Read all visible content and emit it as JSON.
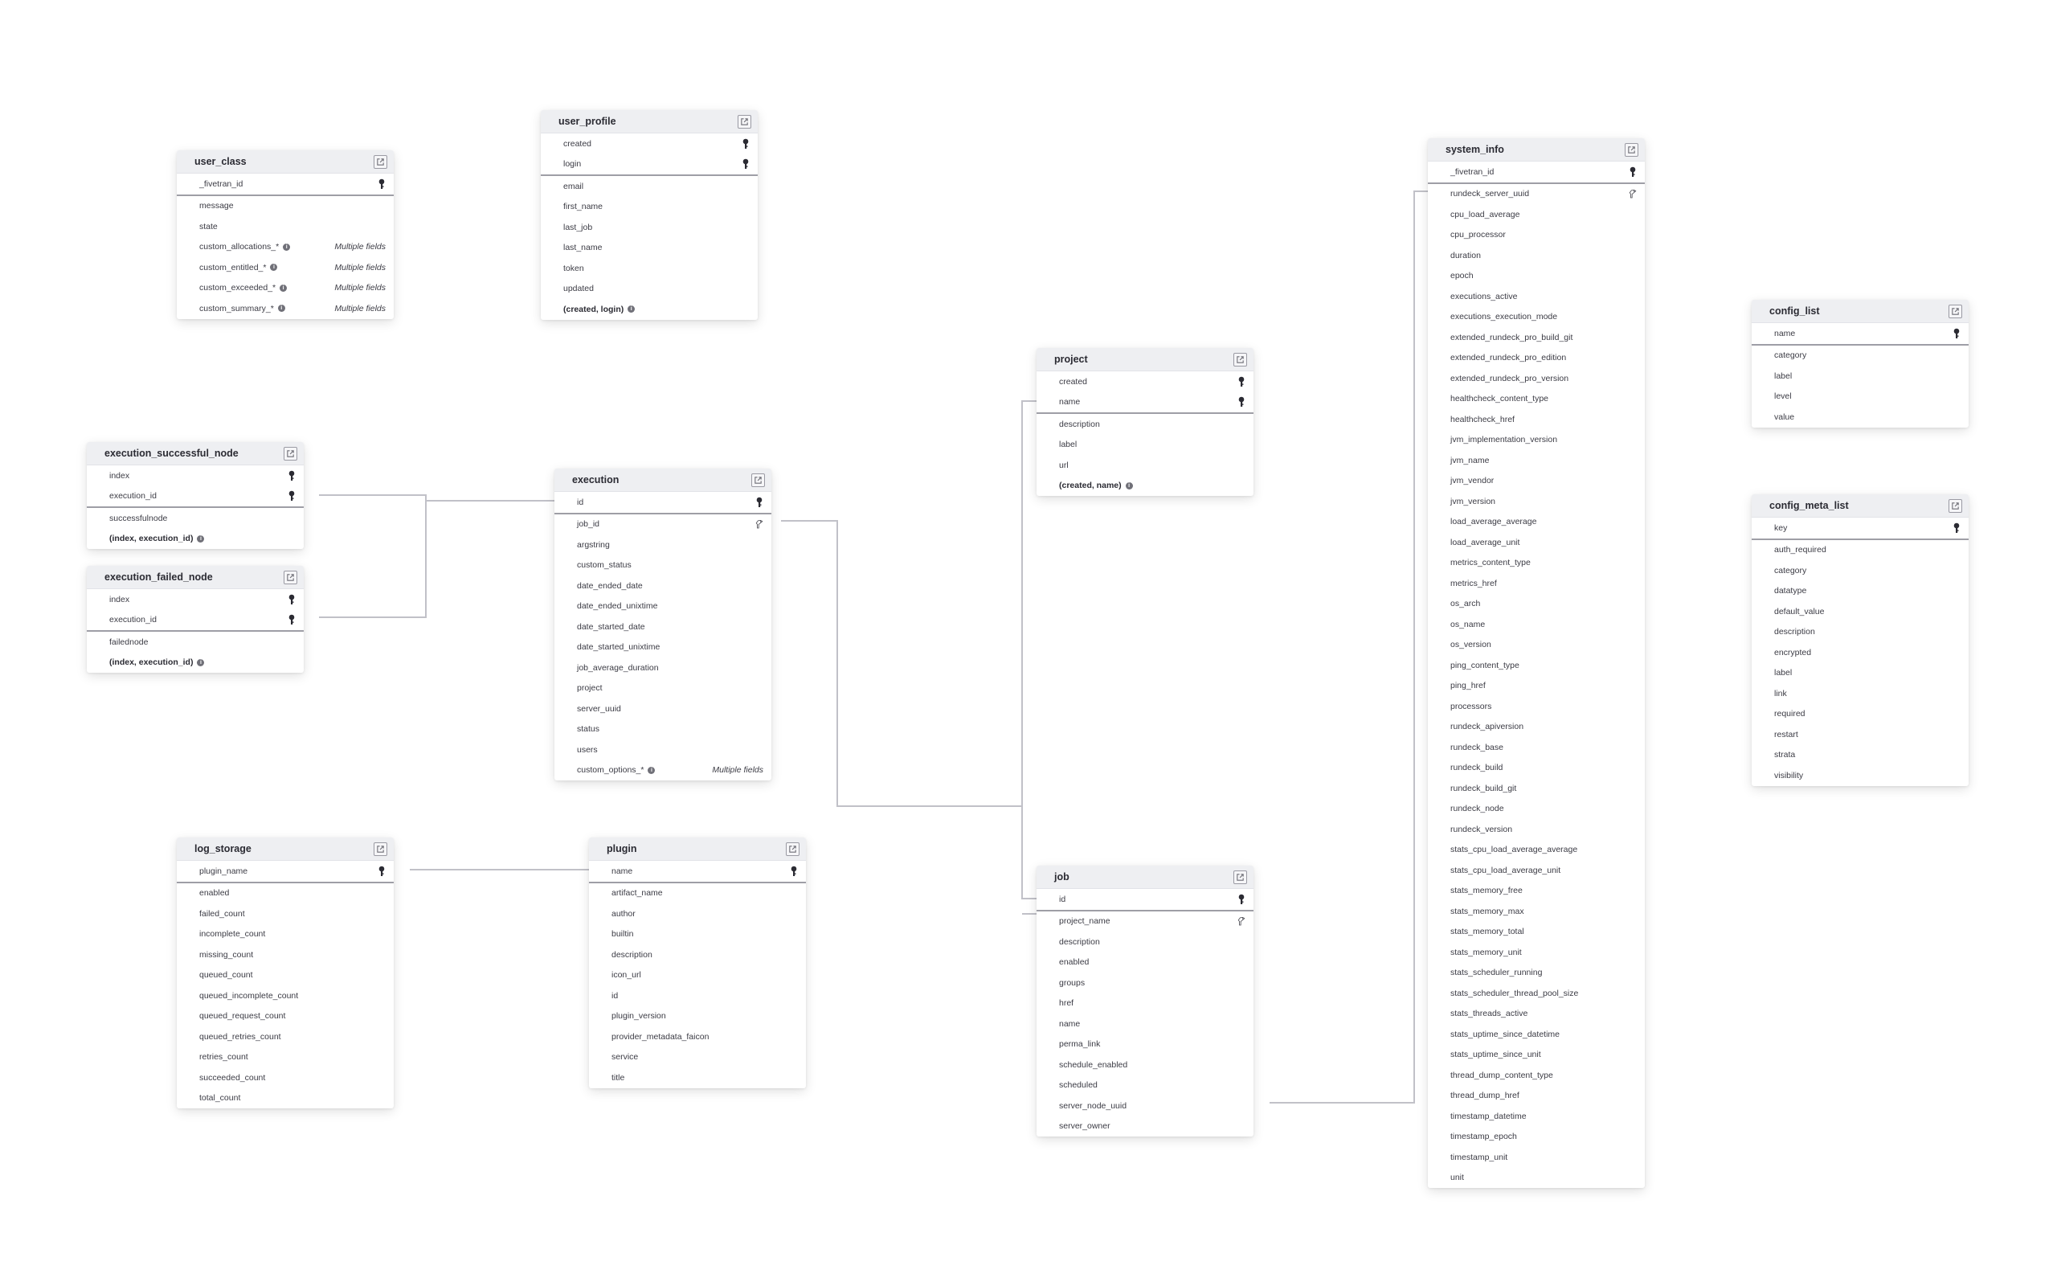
{
  "tables": {
    "user_class": {
      "title": "user_class",
      "pk": [
        {
          "name": "_fivetran_id",
          "icon": "key"
        }
      ],
      "cols": [
        {
          "name": "message"
        },
        {
          "name": "state"
        },
        {
          "name": "custom_allocations_*",
          "info": true,
          "note": "Multiple fields"
        },
        {
          "name": "custom_entitled_*",
          "info": true,
          "note": "Multiple fields"
        },
        {
          "name": "custom_exceeded_*",
          "info": true,
          "note": "Multiple fields"
        },
        {
          "name": "custom_summary_*",
          "info": true,
          "note": "Multiple fields"
        }
      ]
    },
    "user_profile": {
      "title": "user_profile",
      "pk": [
        {
          "name": "created",
          "icon": "key"
        },
        {
          "name": "login",
          "icon": "key"
        }
      ],
      "cols": [
        {
          "name": "email"
        },
        {
          "name": "first_name"
        },
        {
          "name": "last_job"
        },
        {
          "name": "last_name"
        },
        {
          "name": "token"
        },
        {
          "name": "updated"
        },
        {
          "name": "(created, login)",
          "info": true,
          "bold": true
        }
      ]
    },
    "execution_successful_node": {
      "title": "execution_successful_node",
      "pk": [
        {
          "name": "index",
          "icon": "key"
        },
        {
          "name": "execution_id",
          "icon": "key"
        }
      ],
      "cols": [
        {
          "name": "successfulnode"
        },
        {
          "name": "(index, execution_id)",
          "info": true,
          "bold": true
        }
      ]
    },
    "execution_failed_node": {
      "title": "execution_failed_node",
      "pk": [
        {
          "name": "index",
          "icon": "key"
        },
        {
          "name": "execution_id",
          "icon": "key"
        }
      ],
      "cols": [
        {
          "name": "failednode"
        },
        {
          "name": "(index, execution_id)",
          "info": true,
          "bold": true
        }
      ]
    },
    "execution": {
      "title": "execution",
      "pk": [
        {
          "name": "id",
          "icon": "key"
        }
      ],
      "cols": [
        {
          "name": "job_id",
          "icon": "fk"
        },
        {
          "name": "argstring"
        },
        {
          "name": "custom_status"
        },
        {
          "name": "date_ended_date"
        },
        {
          "name": "date_ended_unixtime"
        },
        {
          "name": "date_started_date"
        },
        {
          "name": "date_started_unixtime"
        },
        {
          "name": "job_average_duration"
        },
        {
          "name": "project"
        },
        {
          "name": "server_uuid"
        },
        {
          "name": "status"
        },
        {
          "name": "users"
        },
        {
          "name": "custom_options_*",
          "info": true,
          "note": "Multiple fields"
        }
      ]
    },
    "project": {
      "title": "project",
      "pk": [
        {
          "name": "created",
          "icon": "key"
        },
        {
          "name": "name",
          "icon": "key"
        }
      ],
      "cols": [
        {
          "name": "description"
        },
        {
          "name": "label"
        },
        {
          "name": "url"
        },
        {
          "name": "(created, name)",
          "info": true,
          "bold": true
        }
      ]
    },
    "job": {
      "title": "job",
      "pk": [
        {
          "name": "id",
          "icon": "key"
        }
      ],
      "cols": [
        {
          "name": "project_name",
          "icon": "fk"
        },
        {
          "name": "description"
        },
        {
          "name": "enabled"
        },
        {
          "name": "groups"
        },
        {
          "name": "href"
        },
        {
          "name": "name"
        },
        {
          "name": "perma_link"
        },
        {
          "name": "schedule_enabled"
        },
        {
          "name": "scheduled"
        },
        {
          "name": "server_node_uuid"
        },
        {
          "name": "server_owner"
        }
      ]
    },
    "log_storage": {
      "title": "log_storage",
      "pk": [
        {
          "name": "plugin_name",
          "icon": "key"
        }
      ],
      "cols": [
        {
          "name": "enabled"
        },
        {
          "name": "failed_count"
        },
        {
          "name": "incomplete_count"
        },
        {
          "name": "missing_count"
        },
        {
          "name": "queued_count"
        },
        {
          "name": "queued_incomplete_count"
        },
        {
          "name": "queued_request_count"
        },
        {
          "name": "queued_retries_count"
        },
        {
          "name": "retries_count"
        },
        {
          "name": "succeeded_count"
        },
        {
          "name": "total_count"
        }
      ]
    },
    "plugin": {
      "title": "plugin",
      "pk": [
        {
          "name": "name",
          "icon": "key"
        }
      ],
      "cols": [
        {
          "name": "artifact_name"
        },
        {
          "name": "author"
        },
        {
          "name": "builtin"
        },
        {
          "name": "description"
        },
        {
          "name": "icon_url"
        },
        {
          "name": "id"
        },
        {
          "name": "plugin_version"
        },
        {
          "name": "provider_metadata_faicon"
        },
        {
          "name": "service"
        },
        {
          "name": "title"
        }
      ]
    },
    "system_info": {
      "title": "system_info",
      "pk": [
        {
          "name": "_fivetran_id",
          "icon": "key"
        }
      ],
      "cols": [
        {
          "name": "rundeck_server_uuid",
          "icon": "fk"
        },
        {
          "name": "cpu_load_average"
        },
        {
          "name": "cpu_processor"
        },
        {
          "name": "duration"
        },
        {
          "name": "epoch"
        },
        {
          "name": "executions_active"
        },
        {
          "name": "executions_execution_mode"
        },
        {
          "name": "extended_rundeck_pro_build_git"
        },
        {
          "name": "extended_rundeck_pro_edition"
        },
        {
          "name": "extended_rundeck_pro_version"
        },
        {
          "name": "healthcheck_content_type"
        },
        {
          "name": "healthcheck_href"
        },
        {
          "name": "jvm_implementation_version"
        },
        {
          "name": "jvm_name"
        },
        {
          "name": "jvm_vendor"
        },
        {
          "name": "jvm_version"
        },
        {
          "name": "load_average_average"
        },
        {
          "name": "load_average_unit"
        },
        {
          "name": "metrics_content_type"
        },
        {
          "name": "metrics_href"
        },
        {
          "name": "os_arch"
        },
        {
          "name": "os_name"
        },
        {
          "name": "os_version"
        },
        {
          "name": "ping_content_type"
        },
        {
          "name": "ping_href"
        },
        {
          "name": "processors"
        },
        {
          "name": "rundeck_apiversion"
        },
        {
          "name": "rundeck_base"
        },
        {
          "name": "rundeck_build"
        },
        {
          "name": "rundeck_build_git"
        },
        {
          "name": "rundeck_node"
        },
        {
          "name": "rundeck_version"
        },
        {
          "name": "stats_cpu_load_average_average"
        },
        {
          "name": "stats_cpu_load_average_unit"
        },
        {
          "name": "stats_memory_free"
        },
        {
          "name": "stats_memory_max"
        },
        {
          "name": "stats_memory_total"
        },
        {
          "name": "stats_memory_unit"
        },
        {
          "name": "stats_scheduler_running"
        },
        {
          "name": "stats_scheduler_thread_pool_size"
        },
        {
          "name": "stats_threads_active"
        },
        {
          "name": "stats_uptime_since_datetime"
        },
        {
          "name": "stats_uptime_since_unit"
        },
        {
          "name": "thread_dump_content_type"
        },
        {
          "name": "thread_dump_href"
        },
        {
          "name": "timestamp_datetime"
        },
        {
          "name": "timestamp_epoch"
        },
        {
          "name": "timestamp_unit"
        },
        {
          "name": "unit"
        }
      ]
    },
    "config_list": {
      "title": "config_list",
      "pk": [
        {
          "name": "name",
          "icon": "key"
        }
      ],
      "cols": [
        {
          "name": "category"
        },
        {
          "name": "label"
        },
        {
          "name": "level"
        },
        {
          "name": "value"
        }
      ]
    },
    "config_meta_list": {
      "title": "config_meta_list",
      "pk": [
        {
          "name": "key",
          "icon": "key"
        }
      ],
      "cols": [
        {
          "name": "auth_required"
        },
        {
          "name": "category"
        },
        {
          "name": "datatype"
        },
        {
          "name": "default_value"
        },
        {
          "name": "description"
        },
        {
          "name": "encrypted"
        },
        {
          "name": "label"
        },
        {
          "name": "link"
        },
        {
          "name": "required"
        },
        {
          "name": "restart"
        },
        {
          "name": "strata"
        },
        {
          "name": "visibility"
        }
      ]
    }
  },
  "relationships": [
    {
      "from": "execution_successful_node.execution_id",
      "to": "execution.id"
    },
    {
      "from": "execution_failed_node.execution_id",
      "to": "execution.id"
    },
    {
      "from": "execution.job_id",
      "to": "job.id"
    },
    {
      "from": "job.project_name",
      "to": "project.name"
    },
    {
      "from": "log_storage.plugin_name",
      "to": "plugin.name"
    },
    {
      "from": "system_info.rundeck_server_uuid",
      "to": "job.server_node_uuid"
    }
  ]
}
